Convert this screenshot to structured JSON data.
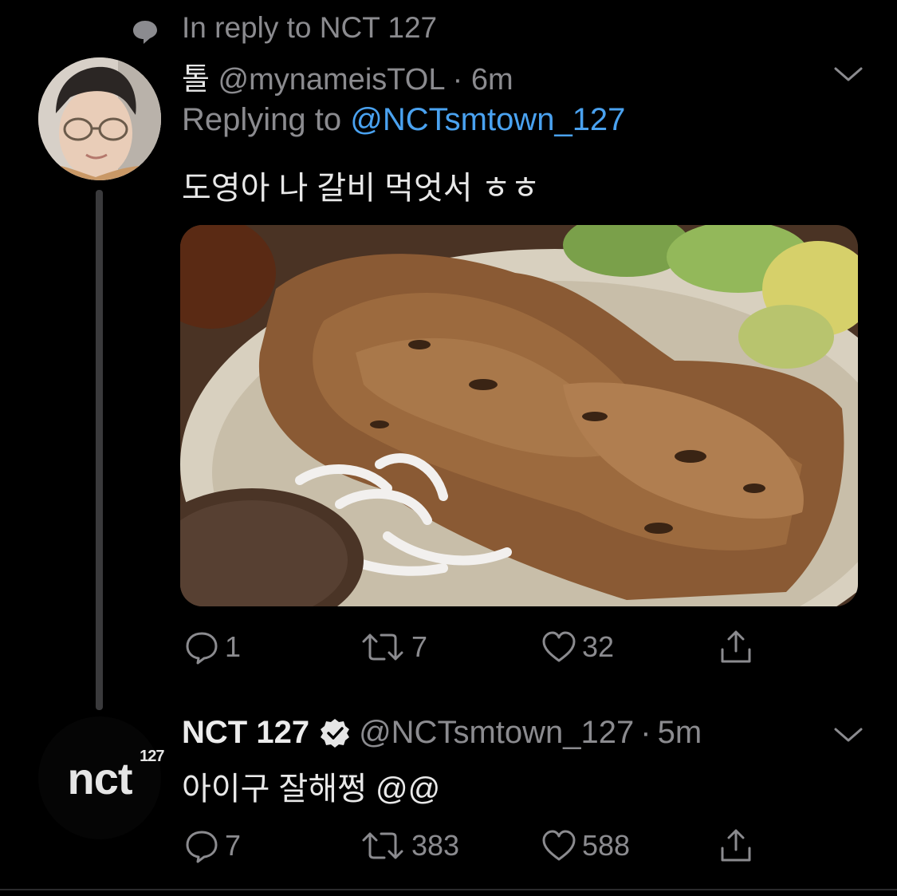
{
  "context": {
    "icon": "speech-bubble-icon",
    "text": "In reply to NCT 127"
  },
  "tweet1": {
    "avatar": "user-avatar-glasses",
    "display_name": "톨",
    "handle": "@mynameisTOL",
    "separator": "·",
    "time": "6m",
    "replying_prefix": "Replying to",
    "replying_mention": "@NCTsmtown_127",
    "text": "도영아 나 갈비 먹엇서 ㅎㅎ",
    "media": "photo-grilled-galbi",
    "actions": {
      "reply_count": "1",
      "retweet_count": "7",
      "like_count": "32"
    }
  },
  "tweet2": {
    "avatar_logo_text": "nct",
    "avatar_logo_sup": "127",
    "display_name": "NCT 127",
    "verified": true,
    "handle": "@NCTsmtown_127",
    "separator": "·",
    "time": "5m",
    "text": "아이구 잘해쩡 @@",
    "actions": {
      "reply_count": "7",
      "retweet_count": "383",
      "like_count": "588"
    }
  },
  "colors": {
    "background": "#000000",
    "secondary_text": "#8b8b8f",
    "primary_text": "#e8e8e8",
    "link": "#4aa2f0",
    "thread_line": "#3a3a3c"
  }
}
